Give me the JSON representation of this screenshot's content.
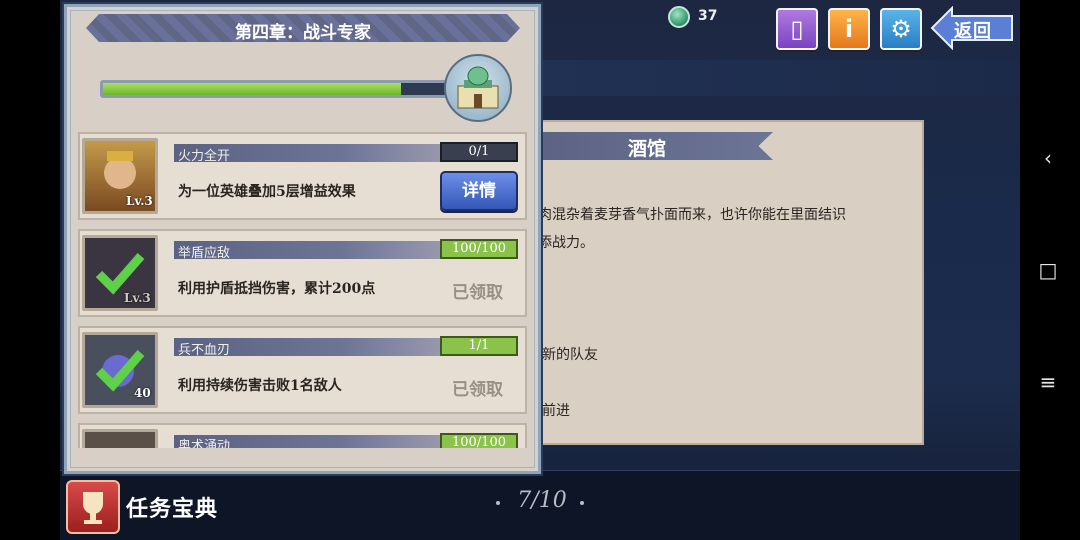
{
  "topbar": {
    "gem_count": "37",
    "back_label": "返回",
    "icons": [
      "gem-icon",
      "book-icon",
      "info-icon",
      "gear-icon",
      "back-arrow-icon"
    ]
  },
  "tavern": {
    "title": "酒馆",
    "line1": "烤肉混杂着麦芽香气扑面而来，也许你能在里面结识",
    "line2": "增添战力。",
    "line3": "新的队友",
    "line4": "前进"
  },
  "quest_panel": {
    "chapter_title": "第四章：战斗专家",
    "progress": 0.86,
    "quests": [
      {
        "name": "火力全开",
        "count": "0/1",
        "desc": "为一位英雄叠加5层增益效果",
        "level": "Lv.3",
        "action": "详情",
        "status": "in_progress"
      },
      {
        "name": "举盾应敌",
        "count": "100/100",
        "desc": "利用护盾抵挡伤害，累计200点",
        "level": "Lv.3",
        "action": "已领取",
        "status": "claimed"
      },
      {
        "name": "兵不血刃",
        "count": "1/1",
        "desc": "利用持续伤害击败1名敌人",
        "level": "40",
        "action": "已领取",
        "status": "claimed"
      },
      {
        "name": "奥术涌动",
        "count": "100/100",
        "desc": "",
        "level": "",
        "action": "",
        "status": "claimed"
      }
    ]
  },
  "bottom": {
    "title": "任务宝典",
    "page_indicator": "7/10"
  },
  "colors": {
    "accent_green": "#8bc34a",
    "ribbon": "#5f6686",
    "button_blue": "#3458b8"
  }
}
